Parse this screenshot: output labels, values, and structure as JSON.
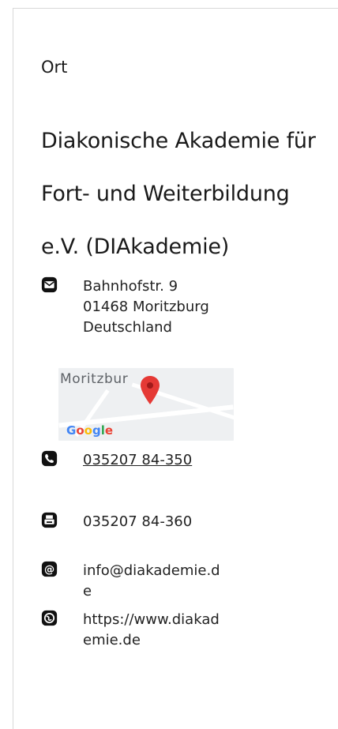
{
  "section": {
    "label": "Ort"
  },
  "venue": {
    "name": "Diakonische Akademie für Fort- und Weiterbildung e.V. (DIAkademie)"
  },
  "address": {
    "text": "Bahnhofstr. 9\n01468 Moritzburg\nDeutschland",
    "icon": "mail-icon"
  },
  "map": {
    "place_label": "Moritzbur",
    "logo": "Google",
    "pin_color": "#e53935"
  },
  "phone": {
    "text": "035207 84-350",
    "icon": "phone-icon"
  },
  "fax": {
    "text": "035207 84-360",
    "icon": "fax-icon"
  },
  "email": {
    "text": "info@diakademie.d\ne",
    "icon": "at-icon"
  },
  "web": {
    "text": "https://www.diakad\nemie.de",
    "icon": "globe-icon"
  }
}
